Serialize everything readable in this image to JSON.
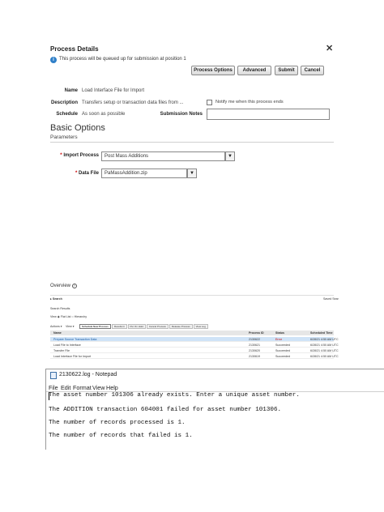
{
  "dialog": {
    "title": "Process Details",
    "close_glyph": "✕",
    "info_icon": "info-icon",
    "info_text": "This process will be queued up for submission at position 1",
    "buttons": {
      "process_options": "Process Options",
      "advanced": "Advanced",
      "submit": "Submit",
      "cancel": "Cancel"
    },
    "fields": {
      "name_label": "Name",
      "name_value": "Load Interface File for Import",
      "description_label": "Description",
      "description_value": "Transfers setup or transaction data files from ...",
      "notify_label": "Notify me when this process ends",
      "schedule_label": "Schedule",
      "schedule_value": "As soon as possible",
      "submission_notes_label": "Submission Notes",
      "submission_notes_value": ""
    },
    "basic_options": "Basic Options",
    "parameters": "Parameters",
    "import_process_label": "Import Process",
    "import_process_value": "Post Mass Additions",
    "data_file_label": "Data File",
    "data_file_value": "PaMassAddition.zip",
    "required_marker": "*",
    "dropdown_glyph": "▼"
  },
  "overview": {
    "title": "Overview",
    "help_glyph": "?",
    "search_label": "Search",
    "saved_search": "Saved Sear",
    "search_results": "Search Results",
    "view_label": "View",
    "view_opt_1": "Flat List",
    "view_opt_2": "Hierarchy",
    "actions": "Actions ▾",
    "view_menu": "View ▾",
    "tabs": [
      "Schedule New Process",
      "Resubmit",
      "Put On Hold",
      "Cancel Process",
      "Release Process",
      "View Log"
    ],
    "columns": {
      "name": "Name",
      "process_id": "Process ID",
      "status": "Status",
      "scheduled_time": "Scheduled Time"
    },
    "rows": [
      {
        "name": "Prepare Source Transaction Data",
        "process_id": "2130622",
        "status": "Error",
        "time": "6/28/21 4:50 AM UTC"
      },
      {
        "name": "Load File to Interface",
        "process_id": "2130621",
        "status": "Succeeded",
        "time": "6/28/21 4:50 AM UTC"
      },
      {
        "name": "Transfer File",
        "process_id": "2130620",
        "status": "Succeeded",
        "time": "6/28/21 4:50 AM UTC"
      },
      {
        "name": "Load Interface File for Import",
        "process_id": "2130619",
        "status": "Succeeded",
        "time": "6/28/21 4:50 AM UTC"
      }
    ]
  },
  "notepad": {
    "title": "2130622.log - Notepad",
    "menu": [
      "File",
      "Edit",
      "Format",
      "View",
      "Help"
    ],
    "lines": [
      "The asset number 101306 already exists. Enter a unique asset number.",
      "The ADDITION transaction 604001 failed for asset number 101306.",
      "The number of records processed is 1.",
      "The number of records that failed is 1."
    ]
  }
}
